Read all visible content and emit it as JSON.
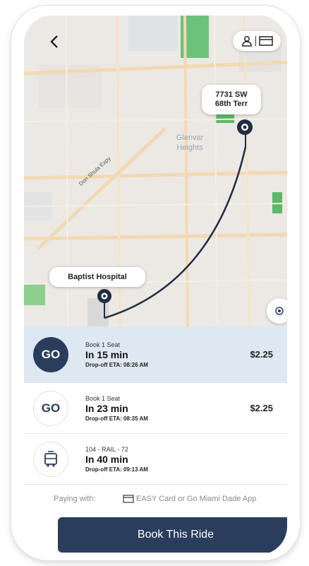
{
  "map": {
    "area_label": "Glenvar\nHeights",
    "road_label": "Don Shula Expy",
    "destination_label_line1": "7731 SW",
    "destination_label_line2": "68th Terr",
    "origin_label": "Baptist Hospital"
  },
  "header": {
    "back_icon": "chevron-left-icon",
    "profile_icon": "person-icon",
    "card_icon": "card-icon"
  },
  "options": [
    {
      "seat": "Book 1 Seat",
      "time": "In 15 min",
      "eta": "Drop-off ETA: 08:26 AM",
      "price": "$2.25",
      "icon": "go-logo",
      "selected": true
    },
    {
      "seat": "Book 1 Seat",
      "time": "In 23 min",
      "eta": "Drop-off ETA: 08:35 AM",
      "price": "$2.25",
      "icon": "go-logo",
      "selected": false
    },
    {
      "seat": "104 - RAIL - 72",
      "time": "In 40 min",
      "eta": "Drop-off ETA: 09:13 AM",
      "price": "",
      "icon": "bus-icon",
      "selected": false
    }
  ],
  "payment": {
    "label": "Paying with:",
    "method": "EASY Card or Go Miami Dade App"
  },
  "book_button": "Book This Ride",
  "colors": {
    "primary": "#2a3d5c",
    "selected_bg": "#dde8f3",
    "park_green": "#5cb86a"
  }
}
